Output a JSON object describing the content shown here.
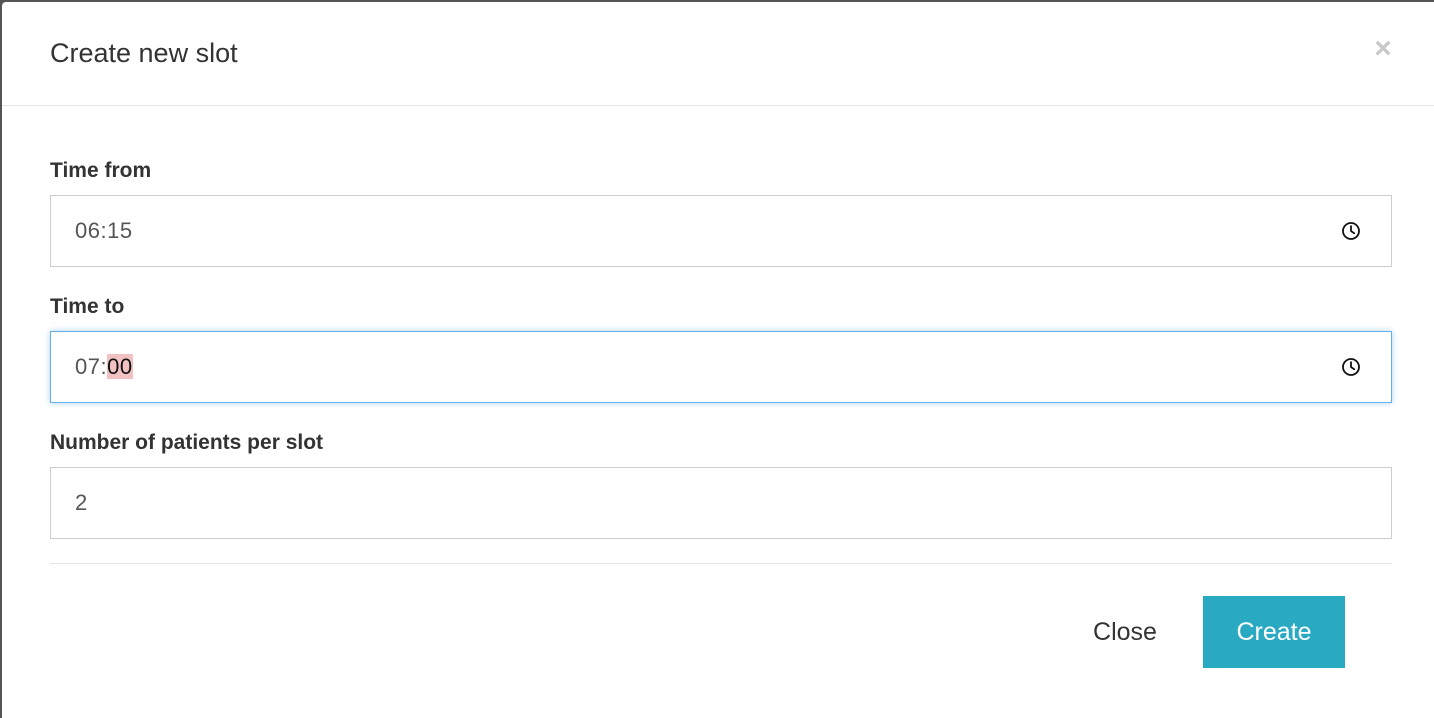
{
  "modal": {
    "title": "Create new slot",
    "close_icon": "close-icon",
    "close_glyph": "×"
  },
  "fields": {
    "time_from": {
      "label": "Time from",
      "hours": "06",
      "separator": ":",
      "minutes": "15",
      "icon": "clock-icon"
    },
    "time_to": {
      "label": "Time to",
      "hours": "07",
      "separator": ":",
      "minutes": "00",
      "icon": "clock-icon"
    },
    "patients_per_slot": {
      "label": "Number of patients per slot",
      "value": "2"
    }
  },
  "footer": {
    "close_label": "Close",
    "create_label": "Create"
  },
  "colors": {
    "primary_button": "#29aac2",
    "focus_border": "#66afe9",
    "segment_highlight": "#f2c2c2"
  }
}
